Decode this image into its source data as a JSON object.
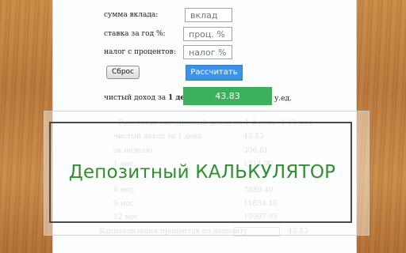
{
  "form": {
    "deposit_label": "сумма вклада:",
    "deposit_placeholder": "вклад",
    "rate_label": "ставка за год %:",
    "rate_placeholder": "проц. %",
    "tax_label": "налог с процентов:",
    "tax_placeholder": "налог %",
    "reset_label": "Сброс",
    "calc_label": "Рассчитать",
    "net_income_prefix": "чистый доход за",
    "net_income_period": "1 день",
    "net_income_value": "43.83",
    "unit_suffix": "у.ед."
  },
  "results": {
    "header": "Рассчитан ежедневный доход по 1-й день: 1-12 мес.",
    "rows": [
      {
        "label": "чистый доход за 1 день",
        "value": "43.83"
      },
      {
        "label": "за неделю",
        "value": "306.81"
      },
      {
        "label": "1 мес.",
        "value": "1314.90"
      },
      {
        "label": "6 мес.",
        "value": "7889.40"
      },
      {
        "label": "9 мес.",
        "value": "11834.10"
      },
      {
        "label": "12 мес.",
        "value": "15997.95"
      }
    ],
    "footer": "Капитализация процентов по депозиту",
    "footer_value": "43.83"
  },
  "overlay": {
    "title": "Депозитный КАЛЬКУЛЯТОР",
    "title_color": "#2f8f2f"
  },
  "colors": {
    "accent_button": "#3f93e6",
    "result_bg": "#3cb05b"
  }
}
